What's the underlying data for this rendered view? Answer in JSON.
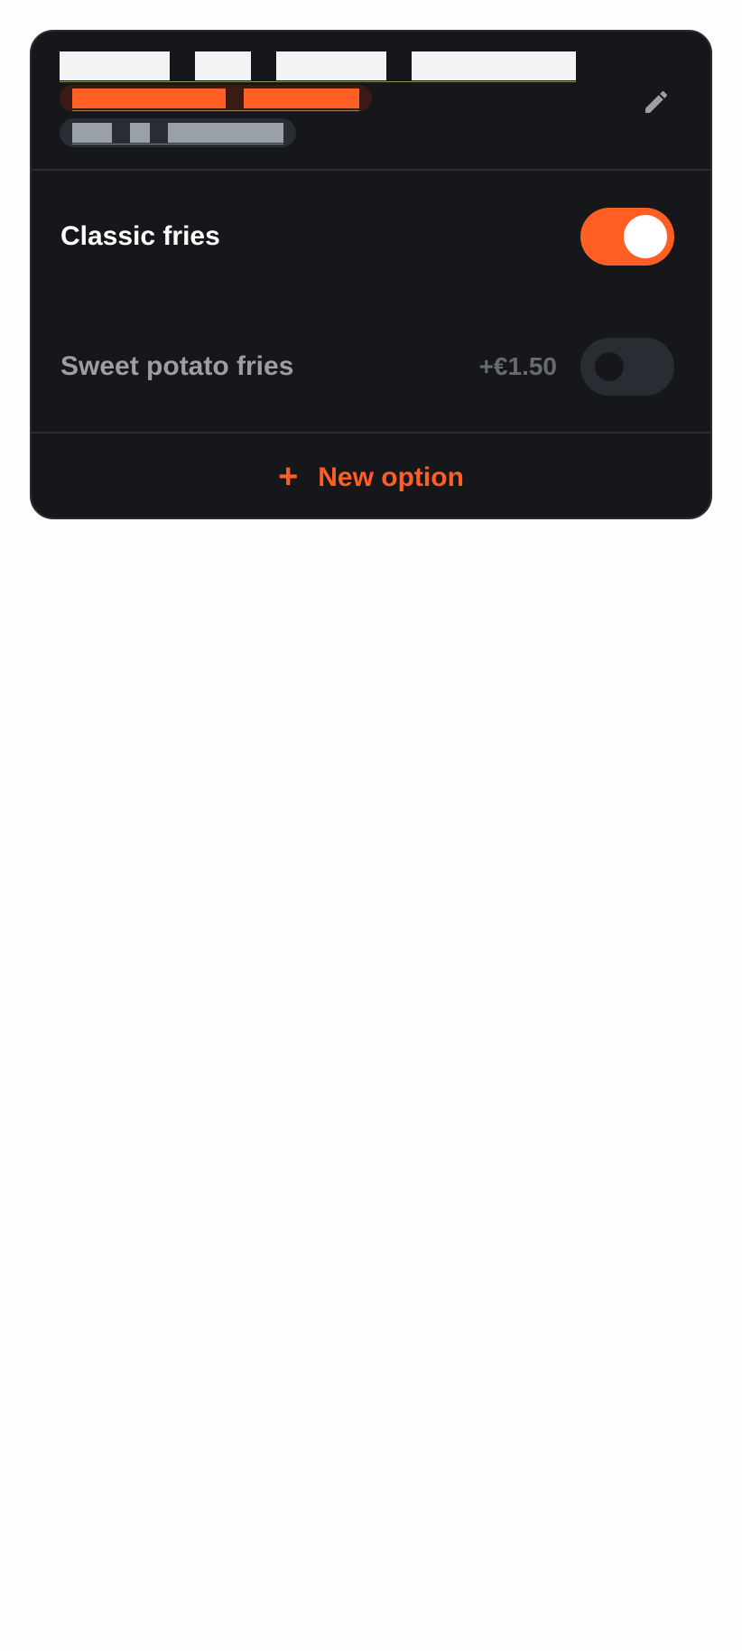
{
  "group": {
    "edit_icon": "pencil-icon"
  },
  "options": [
    {
      "label": "Classic fries",
      "price": "",
      "enabled": true
    },
    {
      "label": "Sweet potato fries",
      "price": "+€1.50",
      "enabled": false
    }
  ],
  "footer": {
    "icon": "plus-icon",
    "plus_glyph": "+",
    "add_label": "New option"
  },
  "colors": {
    "accent": "#ff5f24",
    "card_background": "#16171b",
    "page_background": "#fefefe"
  }
}
